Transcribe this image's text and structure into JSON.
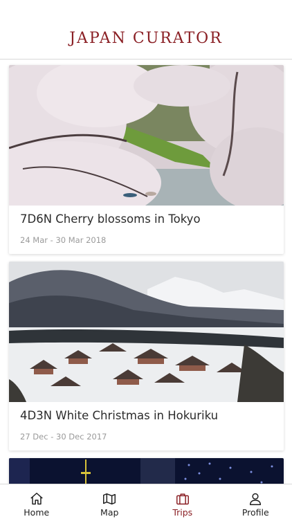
{
  "app": {
    "logo_text": "JAPAN CURATOR"
  },
  "trips": [
    {
      "title": "7D6N Cherry blossoms in Tokyo",
      "dates": "24 Mar - 30 Mar 2018",
      "image": "cherry-blossom-river-photo"
    },
    {
      "title": "4D3N White Christmas in Hokuriku",
      "dates": "27 Dec - 30 Dec 2017",
      "image": "snowy-village-photo"
    },
    {
      "image": "tokyo-tower-illumination-photo"
    }
  ],
  "tabbar": {
    "items": [
      {
        "label": "Home",
        "icon": "home-icon",
        "active": false
      },
      {
        "label": "Map",
        "icon": "map-icon",
        "active": false
      },
      {
        "label": "Trips",
        "icon": "suitcase-icon",
        "active": true
      },
      {
        "label": "Profile",
        "icon": "profile-icon",
        "active": false
      }
    ]
  },
  "colors": {
    "brand": "#8a1f24",
    "text": "#2b2b2b",
    "muted": "#9a9a9a"
  }
}
